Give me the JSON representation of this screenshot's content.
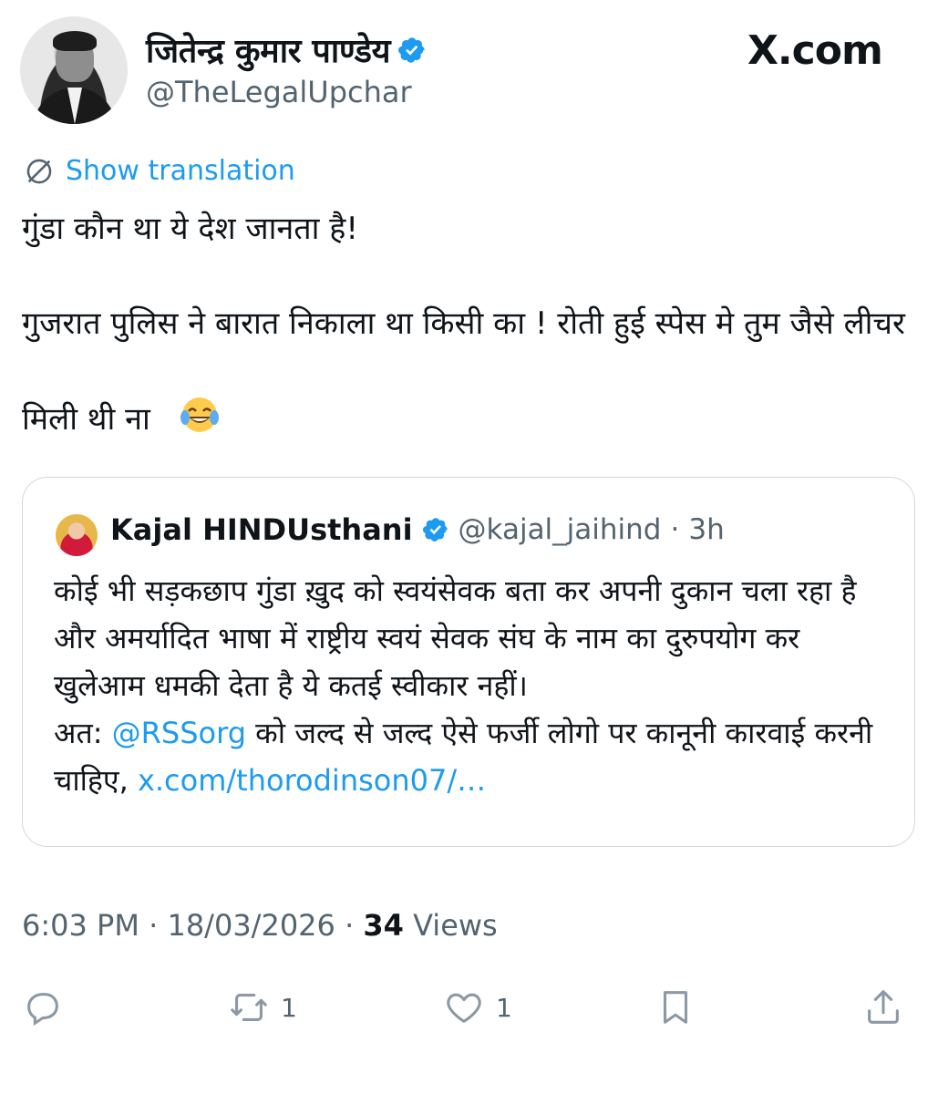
{
  "author": {
    "display_name": "जितेन्द्र कुमार पाण्डेय",
    "handle": "@TheLegalUpchar",
    "verified": true
  },
  "brand": "X.com",
  "translation": {
    "label": "Show translation",
    "icon": "globe-icon"
  },
  "tweet": {
    "text": "गुंडा कौन था ये देश जानता है!\n\nगुजरात पुलिस ने बारात निकाला था किसी का ! रोती हुई स्पेस मे तुम जैसे लीचर मिली थी ना",
    "emoji": "😂"
  },
  "quote": {
    "name": "Kajal HINDUsthani",
    "handle": "@kajal_jaihind",
    "separator": "·",
    "time": "3h",
    "text_part1": "कोई भी सड़कछाप गुंडा ख़ुद को स्वयंसेवक बता कर अपनी दुकान चला रहा है और अमर्यादित भाषा में राष्ट्रीय स्वयं सेवक संघ के नाम का दुरुपयोग कर खुलेआम धमकी देता है ये कतई स्वीकार नहीं।\nअत: ",
    "mention": "@RSSorg",
    "text_part2": " को जल्द से जल्द ऐसे फर्जी लोगो पर कानूनी कारवाई करनी चाहिए, ",
    "link": "x.com/thorodinson07/…"
  },
  "meta": {
    "time": "6:03 PM",
    "date": "18/03/2026",
    "views_count": "34",
    "views_label": "Views",
    "dot": "·"
  },
  "actions": {
    "reply": {
      "icon": "reply-icon",
      "count": ""
    },
    "repost": {
      "icon": "repost-icon",
      "count": "1"
    },
    "like": {
      "icon": "heart-icon",
      "count": "1"
    },
    "bookmark": {
      "icon": "bookmark-icon",
      "count": ""
    },
    "share": {
      "icon": "share-icon",
      "count": ""
    }
  },
  "colors": {
    "accent": "#1d9bf0",
    "secondary_text": "#536471",
    "border": "#cfd9de"
  }
}
